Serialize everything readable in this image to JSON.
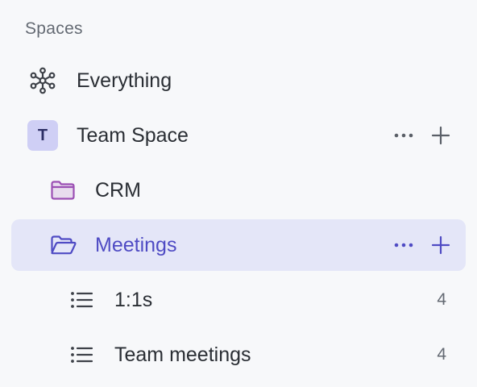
{
  "sidebar": {
    "section_title": "Spaces",
    "everything": {
      "label": "Everything",
      "icon": "hub-icon"
    },
    "team_space": {
      "label": "Team Space",
      "avatar_letter": "T",
      "avatar_color": "#cfcff5"
    },
    "crm": {
      "label": "CRM",
      "icon": "folder-icon",
      "icon_color": "#9b4fb4"
    },
    "meetings": {
      "label": "Meetings",
      "icon": "folder-open-icon",
      "active": true,
      "accent_color": "#4f4bc4"
    },
    "lists": [
      {
        "label": "1:1s",
        "count": "4",
        "icon": "list-icon"
      },
      {
        "label": "Team meetings",
        "count": "4",
        "icon": "list-icon"
      }
    ]
  }
}
